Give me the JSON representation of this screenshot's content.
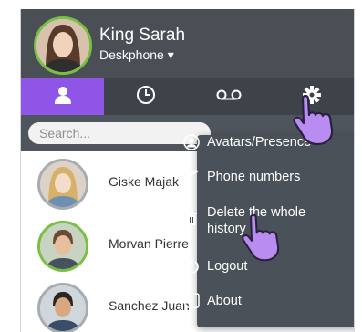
{
  "user": {
    "name": "King Sarah",
    "device": "Deskphone ▾"
  },
  "tabs": [
    {
      "name": "contacts",
      "icon": "person-icon",
      "active": true
    },
    {
      "name": "history",
      "icon": "clock-icon",
      "active": false
    },
    {
      "name": "voicemail",
      "icon": "voicemail-icon",
      "active": false
    },
    {
      "name": "settings",
      "icon": "gear-icon",
      "active": false
    }
  ],
  "search": {
    "placeholder": "Search..."
  },
  "contacts": [
    {
      "name": "Giske Majak"
    },
    {
      "name": "Morvan Pierre"
    },
    {
      "name": "Sanchez Juan"
    }
  ],
  "menu": {
    "items": [
      {
        "label": "Avatars/Presence",
        "icon": "avatar-circle-icon"
      },
      {
        "label": "Phone numbers",
        "icon": "phone-icon"
      },
      {
        "label": "Delete the whole history",
        "icon": "trash-icon"
      },
      {
        "label": "Logout",
        "icon": "power-icon"
      },
      {
        "label": "About",
        "icon": "info-icon"
      }
    ]
  },
  "colors": {
    "accent": "#8e55e6",
    "header": "#4a4f55",
    "presence": "#78c043",
    "menu": "#4b5158"
  }
}
